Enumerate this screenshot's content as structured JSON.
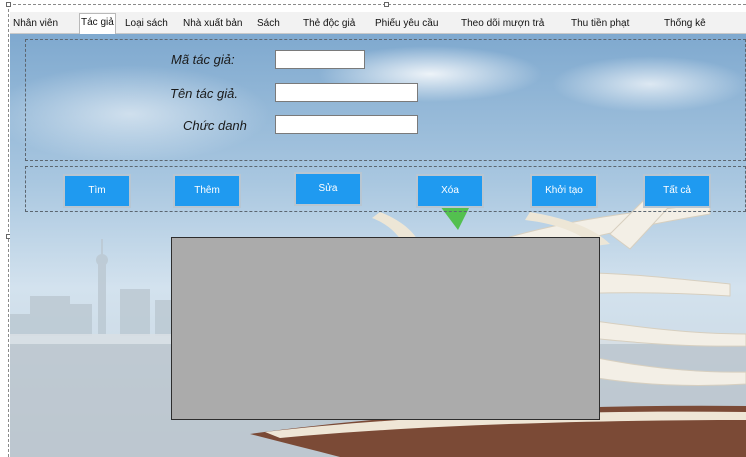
{
  "tabs": [
    "Nhân viên",
    "Tác giả",
    "Loại sách",
    "Nhà xuất bản",
    "Sách",
    "Thẻ độc giả",
    "Phiếu yêu cầu",
    "Theo dõi mượn trả",
    "Thu tiền phạt",
    "Thống kê"
  ],
  "active_tab": "Tác giả",
  "form": {
    "ma_tac_gia_label": "Mã tác giả:",
    "ten_tac_gia_label": "Tên tác giả.",
    "chuc_danh_label": "Chức danh",
    "ma_tac_gia_value": "",
    "ten_tac_gia_value": "",
    "chuc_danh_value": ""
  },
  "buttons": {
    "tim": "Tìm",
    "them": "Thêm",
    "sua": "Sửa",
    "xoa": "Xóa",
    "khoi_tao": "Khởi tạo",
    "tat_ca": "Tất cả"
  },
  "colors": {
    "button_bg": "#1f9af0",
    "grid_bg": "#ababab",
    "tab_bg": "#f2f2f2"
  }
}
